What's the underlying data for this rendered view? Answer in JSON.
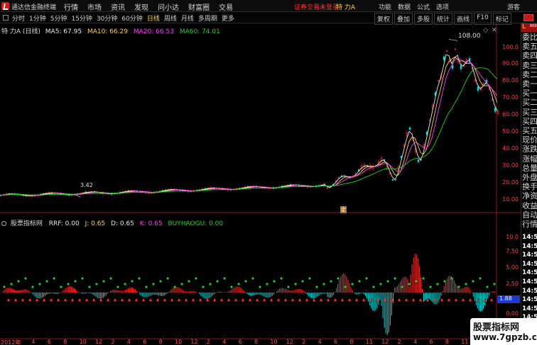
{
  "app": {
    "title": "通达信金融终端",
    "menu": [
      "行情",
      "市场",
      "资讯",
      "发现",
      "问小达",
      "财富圈",
      "交易"
    ],
    "warning": "证券交易未登录",
    "symbol_title": "特 力A",
    "right_menu": [
      "功能",
      "数据",
      "公式",
      "选项"
    ],
    "guest": "游客"
  },
  "periods": {
    "items": [
      "分时",
      "1分钟",
      "5分钟",
      "15分钟",
      "30分钟",
      "60分钟",
      "日线",
      "周线",
      "月线",
      "多周期",
      "更多"
    ],
    "active": "日线"
  },
  "toolbar": {
    "buttons": [
      "复权",
      "叠加",
      "多股",
      "统计",
      "画线",
      "F10",
      "标记"
    ]
  },
  "legend_top": {
    "symbol": "特 力A (日线)",
    "ma5": "MA5: 67.95",
    "ma10": "MA10: 66.29",
    "ma20": "MA20: 66.53",
    "ma60": "MA60: 74.01"
  },
  "legend_bottom": {
    "name": "股票指标网",
    "rrf": "RRF: 0.00",
    "j": "J: 0.65",
    "d": "D: 0.65",
    "k": "K: 0.65",
    "buy": "BUYHAOGU: 0.00"
  },
  "price_axis": [
    "100.0",
    "90.00",
    "80.00",
    "70.00",
    "60.00",
    "50.00",
    "40.00",
    "30.00",
    "20.00",
    "10.00"
  ],
  "indicator_axis": [
    "10.0",
    "7.50",
    "5.00",
    "2.50",
    "0.00",
    "1.88"
  ],
  "annotations": {
    "max": "108.00",
    "min": "3.42",
    "badge": "定"
  },
  "date_axis": [
    "2012年",
    "4",
    "6",
    "8",
    "10",
    "12",
    "2",
    "4",
    "6",
    "8",
    "10",
    "12",
    "2",
    "4",
    "6",
    "8",
    "10",
    "12",
    "2",
    "4",
    "6",
    "8",
    "11",
    "12",
    "2",
    "4",
    "6",
    "8",
    "11",
    "12",
    "2"
  ],
  "sidebar": {
    "header": "L",
    "header_sub": "8000",
    "items": [
      "委比",
      "卖五",
      "卖四",
      "卖三",
      "卖二",
      "卖一",
      "买一",
      "买二",
      "买三",
      "买四",
      "买五",
      "现价",
      "涨跌",
      "涨幅",
      "总量",
      "外盘",
      "换手",
      "净资",
      "收益",
      "自动",
      "行情"
    ],
    "times": [
      "14:56",
      "14:56",
      "14:56",
      "14:56",
      "14:56",
      "14:56",
      "14:56",
      "14:56",
      "14:56",
      "14:56"
    ]
  },
  "watermark": {
    "line1": "股票指标网",
    "line2": "www.7gpzb.com"
  },
  "colors": {
    "up": "#ff3030",
    "down": "#00e0e0",
    "ma5": "#e8e8e8",
    "ma10": "#ffd24a",
    "ma20": "#ff3cff",
    "ma60": "#20d020"
  }
}
